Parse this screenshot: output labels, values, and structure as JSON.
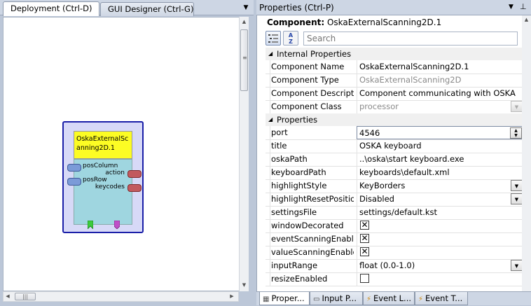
{
  "left_panel": {
    "tabs": [
      {
        "label": "Deployment (Ctrl-D)"
      },
      {
        "label": "GUI Designer (Ctrl-G)"
      }
    ]
  },
  "component_block": {
    "title": "OskaExternalScanning2D.1",
    "inputs": [
      "posColumn",
      "posRow"
    ],
    "outputs": [
      "action",
      "keycodes"
    ],
    "colors": {
      "title_bg": "#fcfc24",
      "body_bg": "#9fd6e0",
      "border": "#1a1fa8",
      "input_port": "#7b9bd8",
      "output_port": "#c25a5e",
      "event_in": "#3ccc3c",
      "event_out": "#c050c8"
    }
  },
  "properties_panel": {
    "title": "Properties (Ctrl-P)",
    "component_label": "Component:",
    "component_name": "OskaExternalScanning2D.1",
    "search_placeholder": "Search",
    "categories": [
      {
        "label": "Internal Properties",
        "rows": [
          {
            "name": "Component Name",
            "value": "OskaExternalScanning2D.1"
          },
          {
            "name": "Component Type",
            "value": "OskaExternalScanning2D"
          },
          {
            "name": "Component Descriptic",
            "value": "Component communicating with OSKA"
          },
          {
            "name": "Component Class",
            "value": "processor"
          }
        ]
      },
      {
        "label": "Properties",
        "rows": [
          {
            "name": "port",
            "value": "4546"
          },
          {
            "name": "title",
            "value": "OSKA keyboard"
          },
          {
            "name": "oskaPath",
            "value": "..\\oska\\start keyboard.exe"
          },
          {
            "name": "keyboardPath",
            "value": "keyboards\\default.xml"
          },
          {
            "name": "highlightStyle",
            "value": "KeyBorders"
          },
          {
            "name": "highlightResetPosition",
            "value": "Disabled"
          },
          {
            "name": "settingsFile",
            "value": "settings/default.kst"
          },
          {
            "name": "windowDecorated",
            "value": "checked"
          },
          {
            "name": "eventScanningEnabled",
            "value": "checked"
          },
          {
            "name": "valueScanningEnabled",
            "value": "checked"
          },
          {
            "name": "inputRange",
            "value": "float (0.0-1.0)"
          },
          {
            "name": "resizeEnabled",
            "value": "unchecked"
          }
        ]
      }
    ]
  },
  "bottom_tabs": [
    {
      "label": "Proper..."
    },
    {
      "label": "Input P..."
    },
    {
      "label": "Event L..."
    },
    {
      "label": "Event T..."
    }
  ]
}
